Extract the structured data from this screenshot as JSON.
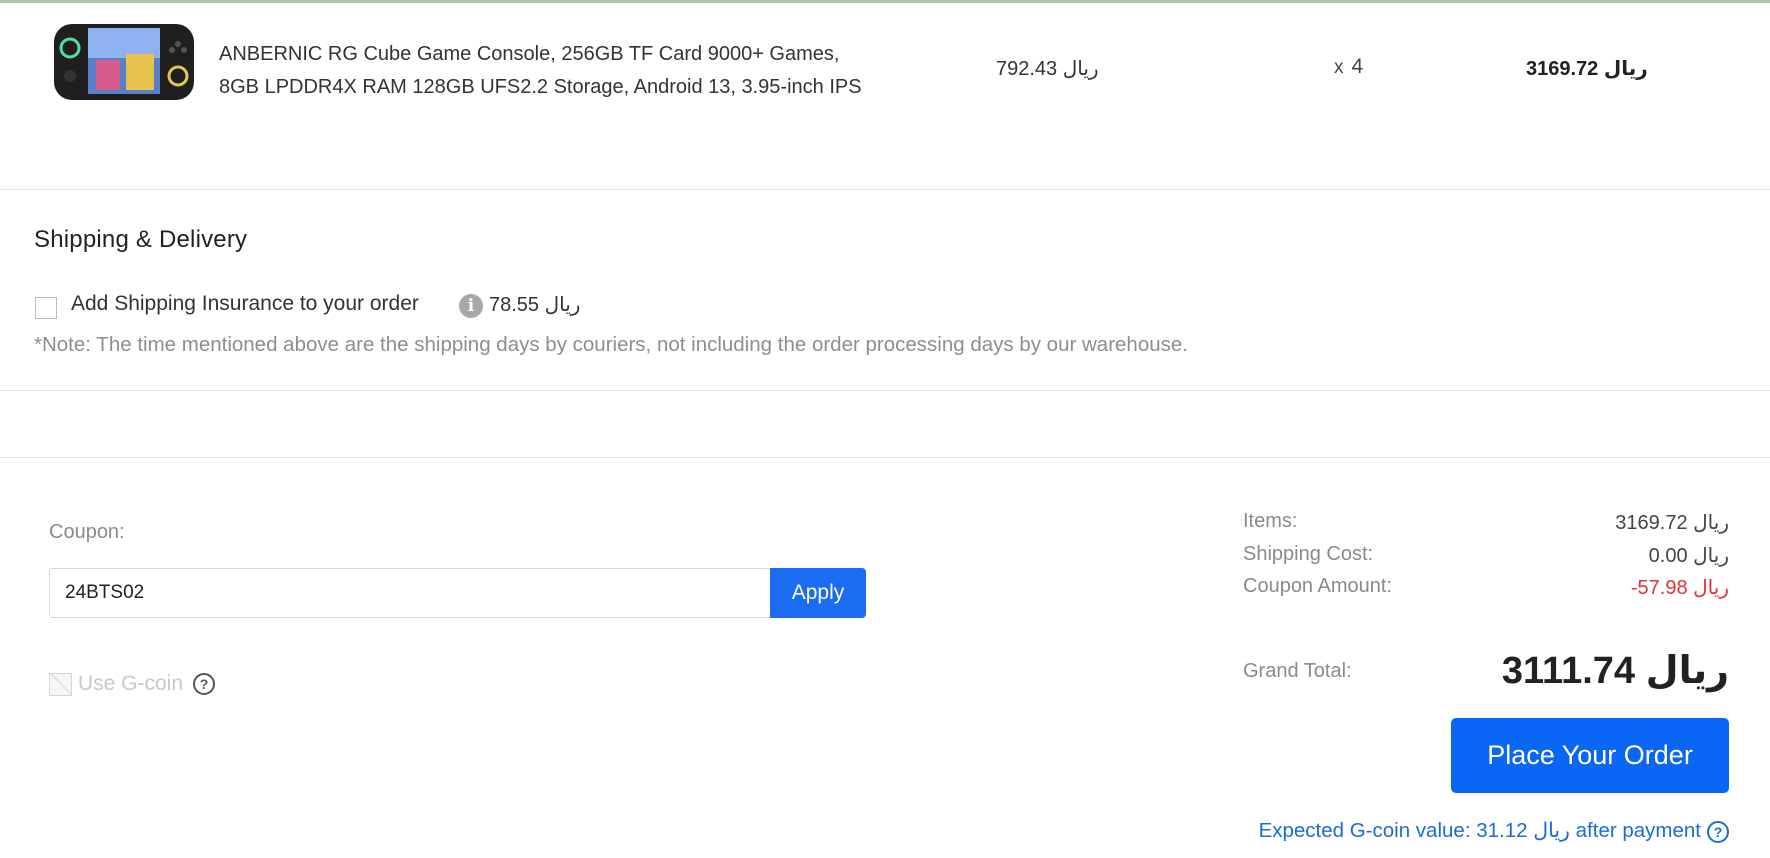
{
  "product": {
    "name_line1": "ANBERNIC RG Cube Game Console, 256GB TF Card 9000+ Games,",
    "name_line2": "8GB LPDDR4X RAM 128GB UFS2.2 Storage, Android 13, 3.95-inch IPS",
    "unit_price": "792.43 ريال",
    "qty_prefix": "x",
    "qty": "4",
    "line_total": "3169.72 ريال"
  },
  "shipping": {
    "title": "Shipping & Delivery",
    "insurance_label": "Add Shipping Insurance to your order",
    "insurance_info_icon": "i",
    "insurance_price": "78.55 ريال",
    "note": "*Note: The time mentioned above are the shipping days by couriers, not including the order processing days by our warehouse."
  },
  "coupon": {
    "label": "Coupon:",
    "value": "24BTS02",
    "apply_label": "Apply"
  },
  "gcoin": {
    "label": "Use G-coin",
    "help_icon": "?"
  },
  "summary": {
    "items_label": "Items:",
    "items_value": "3169.72 ريال",
    "shipping_label": "Shipping Cost:",
    "shipping_value": "0.00 ريال",
    "coupon_label": "Coupon Amount:",
    "coupon_value": "-57.98 ريال",
    "grand_label": "Grand Total:",
    "grand_value": "3111.74 ريال"
  },
  "order": {
    "place_label": "Place Your Order",
    "expected_text": "Expected G-coin value: 31.12 ريال after payment",
    "help_icon": "?"
  },
  "colors": {
    "accent": "#0a66f5",
    "coupon_red": "#e0303a",
    "link_blue": "#1a6cd6"
  }
}
